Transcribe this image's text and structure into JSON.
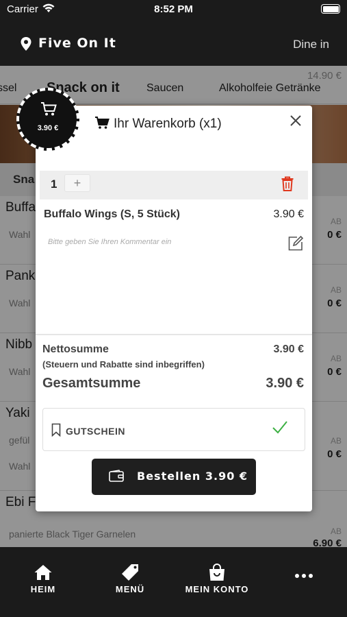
{
  "status": {
    "carrier": "Carrier",
    "time": "8:52 PM"
  },
  "header": {
    "restaurant": "Five On It",
    "mode": "Dine in"
  },
  "categories": [
    "ssel",
    "Snack on it",
    "Saucen",
    "Alkoholfeie Getränke"
  ],
  "faint_price": "14.90 €",
  "section_title": "Sna",
  "menu_items": [
    {
      "title": "Buffa",
      "desc": "Wahl",
      "desc2": "",
      "ab": "AB",
      "price": "0 €"
    },
    {
      "title": "Pank",
      "desc": "Wahl",
      "desc2": "",
      "ab": "AB",
      "price": "0 €"
    },
    {
      "title": "Nibb",
      "desc": "Wahl",
      "desc2": "",
      "ab": "AB",
      "price": "0 €"
    },
    {
      "title": "Yaki",
      "desc": "gefül",
      "desc2": "Wahl",
      "ab": "AB",
      "price": "0 €"
    },
    {
      "title": "Ebi F",
      "desc": "panierte Black Tiger Garnelen",
      "desc2": "",
      "ab": "AB",
      "price": "6.90 €"
    }
  ],
  "cart_badge": {
    "amount": "3.90 €"
  },
  "cart": {
    "title": "Ihr Warenkorb (x1)",
    "quantity": "1",
    "plus": "+",
    "item_name": "Buffalo Wings (S, 5 Stück)",
    "item_price": "3.90 €",
    "comment_placeholder": "Bitte geben Sie Ihren Kommentar ein",
    "net_label": "Nettosumme",
    "net_note": "(Steuern und Rabatte sind inbegriffen)",
    "net_value": "3.90 €",
    "total_label": "Gesamtsumme",
    "total_value": "3.90 €",
    "coupon_label": "GUTSCHEIN",
    "order_button": "Bestellen 3.90 €"
  },
  "nav": {
    "home": "HEIM",
    "menu": "MENÜ",
    "account": "MEIN KONTO"
  },
  "colors": {
    "dark": "#1b1b1b",
    "trash": "#e0391f",
    "check": "#3cb043"
  }
}
